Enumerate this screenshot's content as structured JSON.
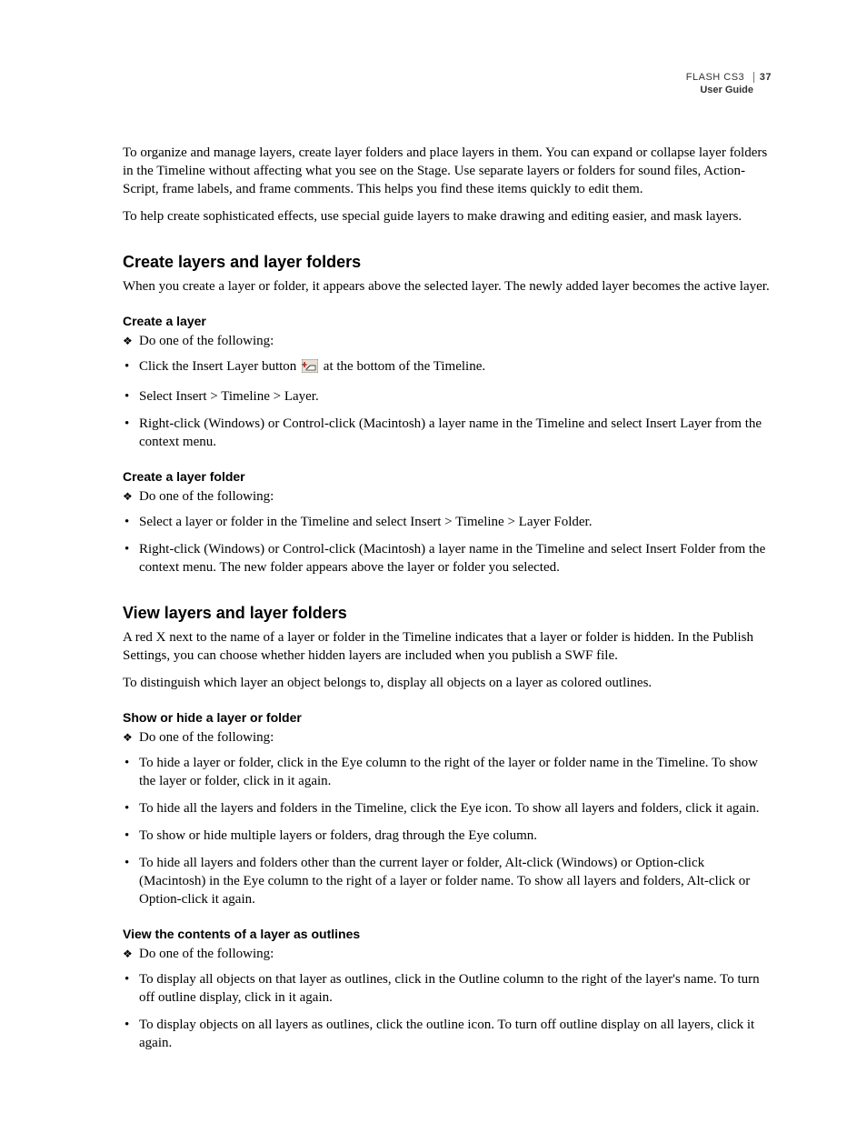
{
  "header": {
    "product": "FLASH CS3",
    "page_number": "37",
    "subtitle": "User Guide"
  },
  "intro": {
    "p1": "To organize and manage layers, create layer folders and place layers in them. You can expand or collapse layer folders in the Timeline without affecting what you see on the Stage. Use separate layers or folders for sound files, Action­Script, frame labels, and frame comments. This helps you find these items quickly to edit them.",
    "p2": "To help create sophisticated effects, use special guide layers to make drawing and editing easier, and mask layers."
  },
  "section1": {
    "title": "Create layers and layer folders",
    "p1": "When you create a layer or folder, it appears above the selected layer. The newly added layer becomes the active layer.",
    "sub1": {
      "title": "Create a layer",
      "lead": "Do one of the following:",
      "item1a": "Click the Insert Layer button ",
      "item1b": " at the bottom of the Timeline.",
      "item2": "Select Insert > Timeline > Layer.",
      "item3": "Right-click (Windows) or Control-click (Macintosh) a layer name in the Timeline and select Insert Layer from the context menu."
    },
    "sub2": {
      "title": "Create a layer folder",
      "lead": "Do one of the following:",
      "item1": "Select a layer or folder in the Timeline and select Insert > Timeline > Layer Folder.",
      "item2": "Right-click (Windows) or Control-click (Macintosh) a layer name in the Timeline and select Insert Folder from the context menu. The new folder appears above the layer or folder you selected."
    }
  },
  "section2": {
    "title": "View layers and layer folders",
    "p1": "A red X next to the name of a layer or folder in the Timeline indicates that a layer or folder is hidden. In the Publish Settings, you can choose whether hidden layers are included when you publish a SWF file.",
    "p2": "To distinguish which layer an object belongs to, display all objects on a layer as colored outlines.",
    "sub1": {
      "title": "Show or hide a layer or folder",
      "lead": "Do one of the following:",
      "item1": "To hide a layer or folder, click in the Eye column to the right of the layer or folder name in the Timeline. To show the layer or folder, click in it again.",
      "item2": "To hide all the layers and folders in the Timeline, click the Eye icon. To show all layers and folders, click it again.",
      "item3": "To show or hide multiple layers or folders, drag through the Eye column.",
      "item4": "To hide all layers and folders other than the current layer or folder, Alt-click (Windows) or Option-click (Macintosh) in the Eye column to the right of a layer or folder name. To show all layers and folders, Alt-click or Option-click it again."
    },
    "sub2": {
      "title": "View the contents of a layer as outlines",
      "lead": "Do one of the following:",
      "item1": "To display all objects on that layer as outlines, click in the Outline column to the right of the layer's name. To turn off outline display, click in it again.",
      "item2": "To display objects on all layers as outlines, click the outline icon. To turn off outline display on all layers, click it again."
    }
  }
}
